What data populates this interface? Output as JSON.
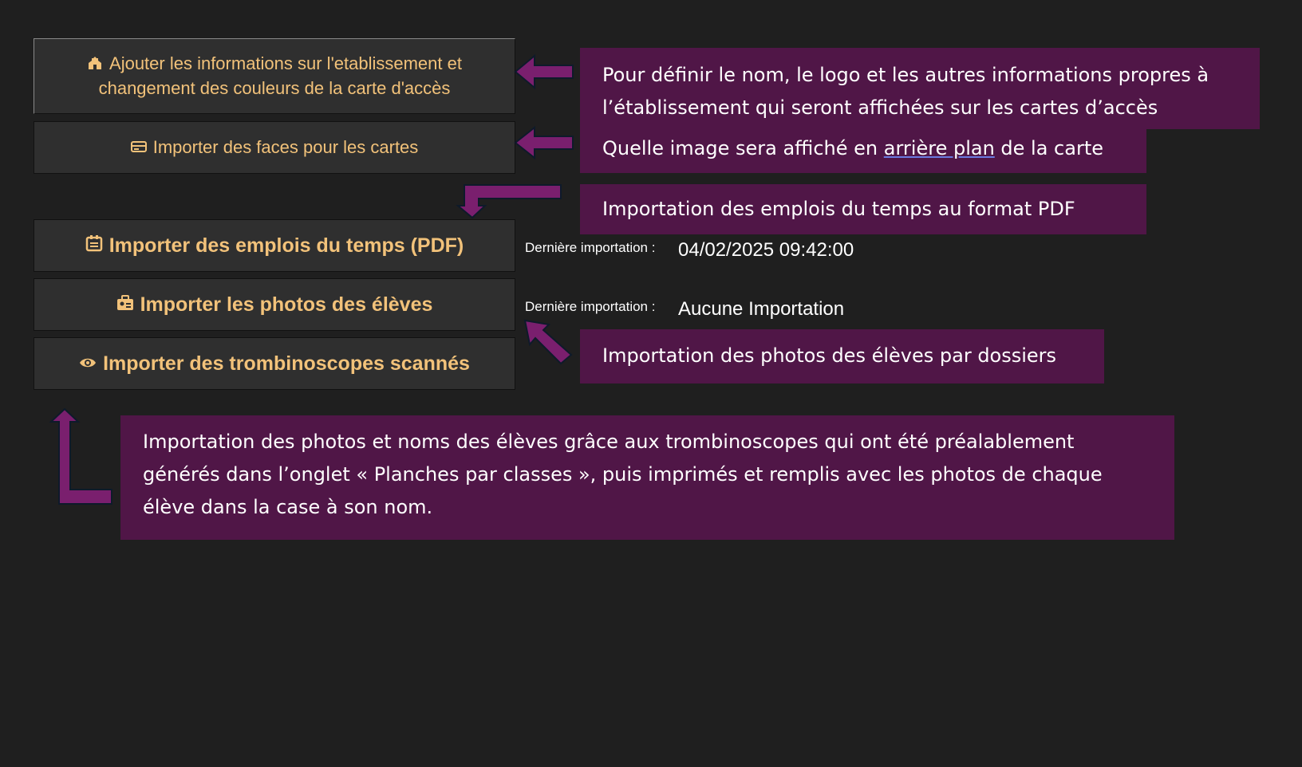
{
  "buttons": {
    "etablissement_line1": "Ajouter les informations sur l'etablissement et",
    "etablissement_line2": "changement des couleurs de la carte d'accès",
    "faces": "Importer des faces pour les cartes",
    "emplois": "Importer des emplois du temps (PDF)",
    "photos": "Importer les photos des élèves",
    "trombinoscopes": "Importer des trombinoscopes scannés"
  },
  "status": {
    "emplois_label": "Dernière importation :",
    "emplois_value": "04/02/2025 09:42:00",
    "photos_label": "Dernière importation :",
    "photos_value": "Aucune Importation"
  },
  "notes": {
    "etablissement_line1": "Pour définir le nom, le logo et les autres informations propres à",
    "etablissement_line2": "l’établissement qui seront affichées sur les cartes d’accès",
    "faces_before": "Quelle image sera affiché en ",
    "faces_underlined": "arrière plan",
    "faces_after": " de la carte",
    "emplois": "Importation des emplois du temps au format PDF",
    "photos": "Importation des photos des élèves par dossiers",
    "trombi_line1": "Importation des photos et noms des élèves grâce aux trombinoscopes qui ont été préalablement",
    "trombi_line2": "générés dans l’onglet « Planches par classes », puis imprimés et remplis avec les photos de chaque",
    "trombi_line3": "élève dans la case à son nom."
  },
  "icons": {
    "etablissement": "school-icon",
    "faces": "card-icon",
    "emplois": "calendar-icon",
    "photos": "photo-id-icon",
    "trombinoscopes": "eye-scan-icon"
  },
  "colors": {
    "background": "#1f1f1f",
    "button_bg": "#2f2f2f",
    "button_text": "#f2c27a",
    "note_bg": "#501647",
    "arrow": "#7a1f6e"
  }
}
